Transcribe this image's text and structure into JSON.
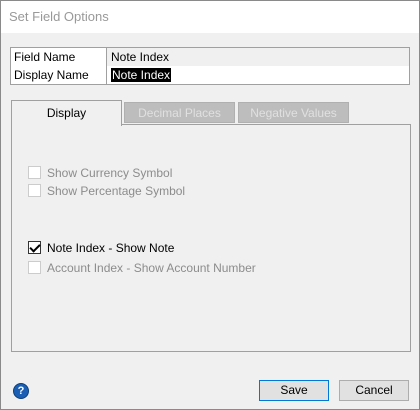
{
  "window": {
    "title": "Set Field Options"
  },
  "fields": {
    "field_name": {
      "label": "Field Name",
      "value": "Note Index"
    },
    "display_name": {
      "label": "Display Name",
      "value": "Note Index"
    }
  },
  "tabs": [
    {
      "label": "Display",
      "active": true
    },
    {
      "label": "Decimal Places",
      "active": false
    },
    {
      "label": "Negative Values",
      "active": false
    }
  ],
  "options": {
    "show_currency": {
      "label": "Show Currency Symbol",
      "checked": false,
      "enabled": false
    },
    "show_percentage": {
      "label": "Show Percentage Symbol",
      "checked": false,
      "enabled": false
    },
    "note_index_show_note": {
      "label": "Note Index - Show Note",
      "checked": true,
      "enabled": true
    },
    "account_index_show_number": {
      "label": "Account Index - Show Account Number",
      "checked": false,
      "enabled": false
    }
  },
  "footer": {
    "help_icon": "question-icon",
    "save_label": "Save",
    "cancel_label": "Cancel"
  }
}
